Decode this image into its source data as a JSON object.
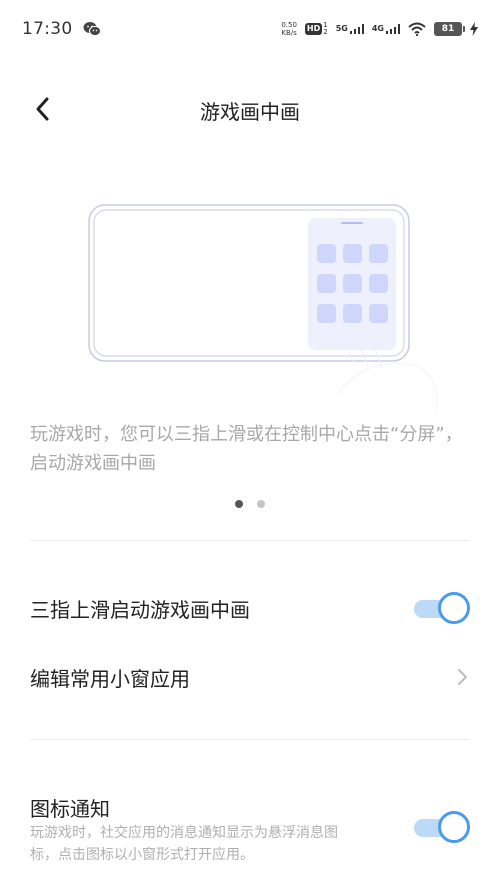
{
  "status_bar": {
    "time": "17:30",
    "net_speed_value": "0.50",
    "net_speed_unit": "KB/s",
    "hd_label": "HD",
    "hd_sim1": "1",
    "hd_sim2": "2",
    "signal1_label": "5G",
    "signal2_label": "4G",
    "battery": "81"
  },
  "header": {
    "title": "游戏画中画"
  },
  "intro": {
    "description": "玩游戏时，您可以三指上滑或在控制中心点击“分屏”，启动游戏画中画"
  },
  "settings": {
    "three_finger": {
      "label": "三指上滑启动游戏画中画",
      "enabled": true
    },
    "edit_apps": {
      "label": "编辑常用小窗应用"
    },
    "icon_notify": {
      "label": "图标通知",
      "sublabel": "玩游戏时，社交应用的消息通知显示为悬浮消息图标，点击图标以小窗形式打开应用。",
      "enabled": true
    }
  },
  "colors": {
    "accent": "#4a9be8",
    "toggle_track": "#bcd9f7",
    "illustration_tile": "#cfd6fb"
  },
  "icons": {
    "back": "chevron-left-icon",
    "wechat": "wechat-icon",
    "wifi": "wifi-icon",
    "charging": "lightning-icon",
    "chevron_right": "chevron-right-icon"
  }
}
